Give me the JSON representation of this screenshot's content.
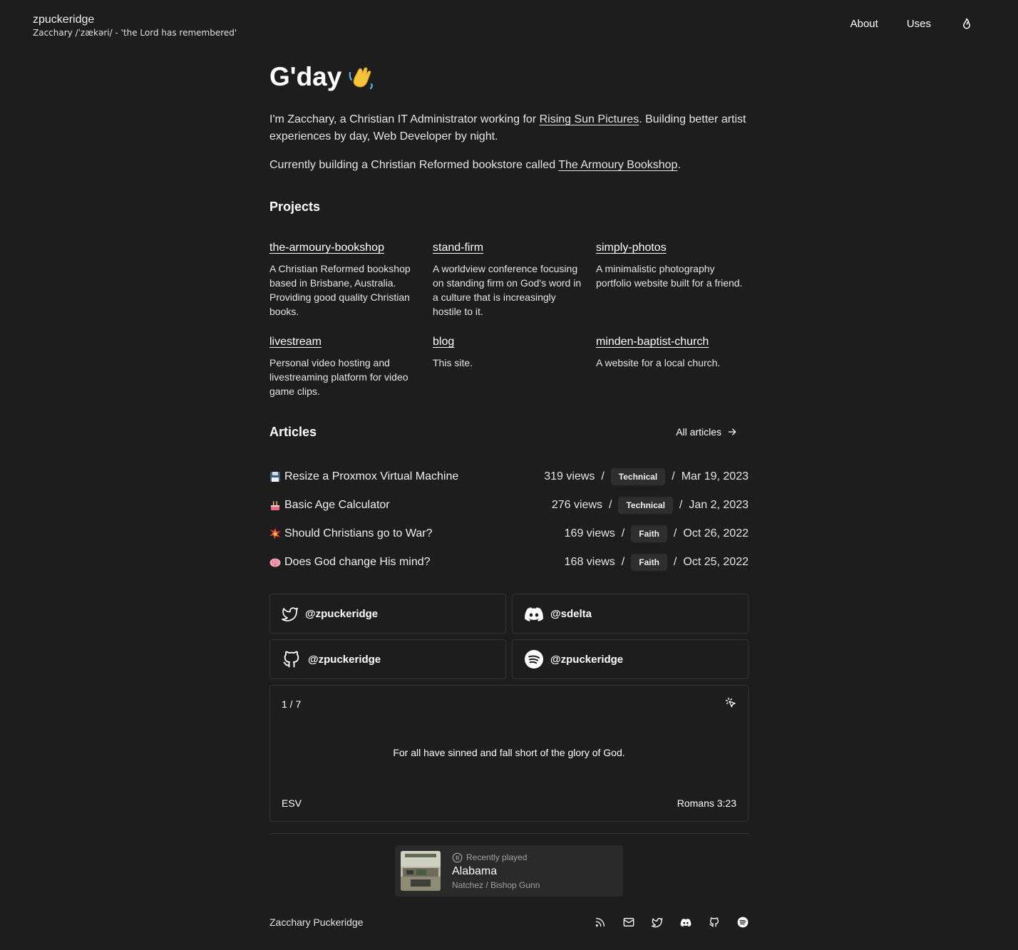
{
  "header": {
    "site_name": "zpuckeridge",
    "subtitle": "Zacchary /ˈzækəri/ - 'the Lord has remembered'",
    "nav": {
      "about": "About",
      "uses": "Uses"
    }
  },
  "hero": {
    "greeting": "G'day"
  },
  "intro": {
    "p1_before": "I'm Zacchary, a Christian IT Administrator working for ",
    "p1_link": "Rising Sun Pictures",
    "p1_after": ". Building better artist experiences by day, Web Developer by night.",
    "p2_before": "Currently building a Christian Reformed bookstore called ",
    "p2_link": "The Armoury Bookshop",
    "p2_after": "."
  },
  "projects": {
    "title": "Projects",
    "items": [
      {
        "name": "the-armoury-bookshop",
        "description": "A Christian Reformed bookshop based in Brisbane, Australia. Providing good quality Christian books."
      },
      {
        "name": "stand-firm",
        "description": "A worldview conference focusing on standing firm on God's word in a culture that is increasingly hostile to it."
      },
      {
        "name": "simply-photos",
        "description": "A minimalistic photography portfolio website built for a friend."
      },
      {
        "name": "livestream",
        "description": "Personal video hosting and livestreaming platform for video game clips."
      },
      {
        "name": "blog",
        "description": "This site."
      },
      {
        "name": "minden-baptist-church",
        "description": "A website for a local church."
      }
    ]
  },
  "articles": {
    "title": "Articles",
    "all_label": "All articles",
    "items": [
      {
        "emoji": "floppy-disk-icon",
        "title": "Resize a Proxmox Virtual Machine",
        "views": "319 views",
        "tag": "Technical",
        "date": "Mar 19, 2023"
      },
      {
        "emoji": "birthday-cake-icon",
        "title": "Basic Age Calculator",
        "views": "276 views",
        "tag": "Technical",
        "date": "Jan 2, 2023"
      },
      {
        "emoji": "collision-icon",
        "title": "Should Christians go to War?",
        "views": "169 views",
        "tag": "Faith",
        "date": "Oct 26, 2022"
      },
      {
        "emoji": "brain-icon",
        "title": "Does God change His mind?",
        "views": "168 views",
        "tag": "Faith",
        "date": "Oct 25, 2022"
      }
    ],
    "separator": "/"
  },
  "socials": {
    "twitter": "@zpuckeridge",
    "discord": "@sdelta",
    "github": "@zpuckeridge",
    "spotify": "@zpuckeridge"
  },
  "verse": {
    "counter": "1 / 7",
    "text": "For all have sinned and fall short of the glory of God.",
    "version": "ESV",
    "reference": "Romans 3:23"
  },
  "now_playing": {
    "status": "Recently played",
    "title": "Alabama",
    "artist": "Natchez / Bishop Gunn"
  },
  "footer": {
    "name": "Zacchary Puckeridge"
  },
  "colors": {
    "background": "#1d1d1d",
    "border": "#333333",
    "tag_bg": "#2e2e2e"
  }
}
